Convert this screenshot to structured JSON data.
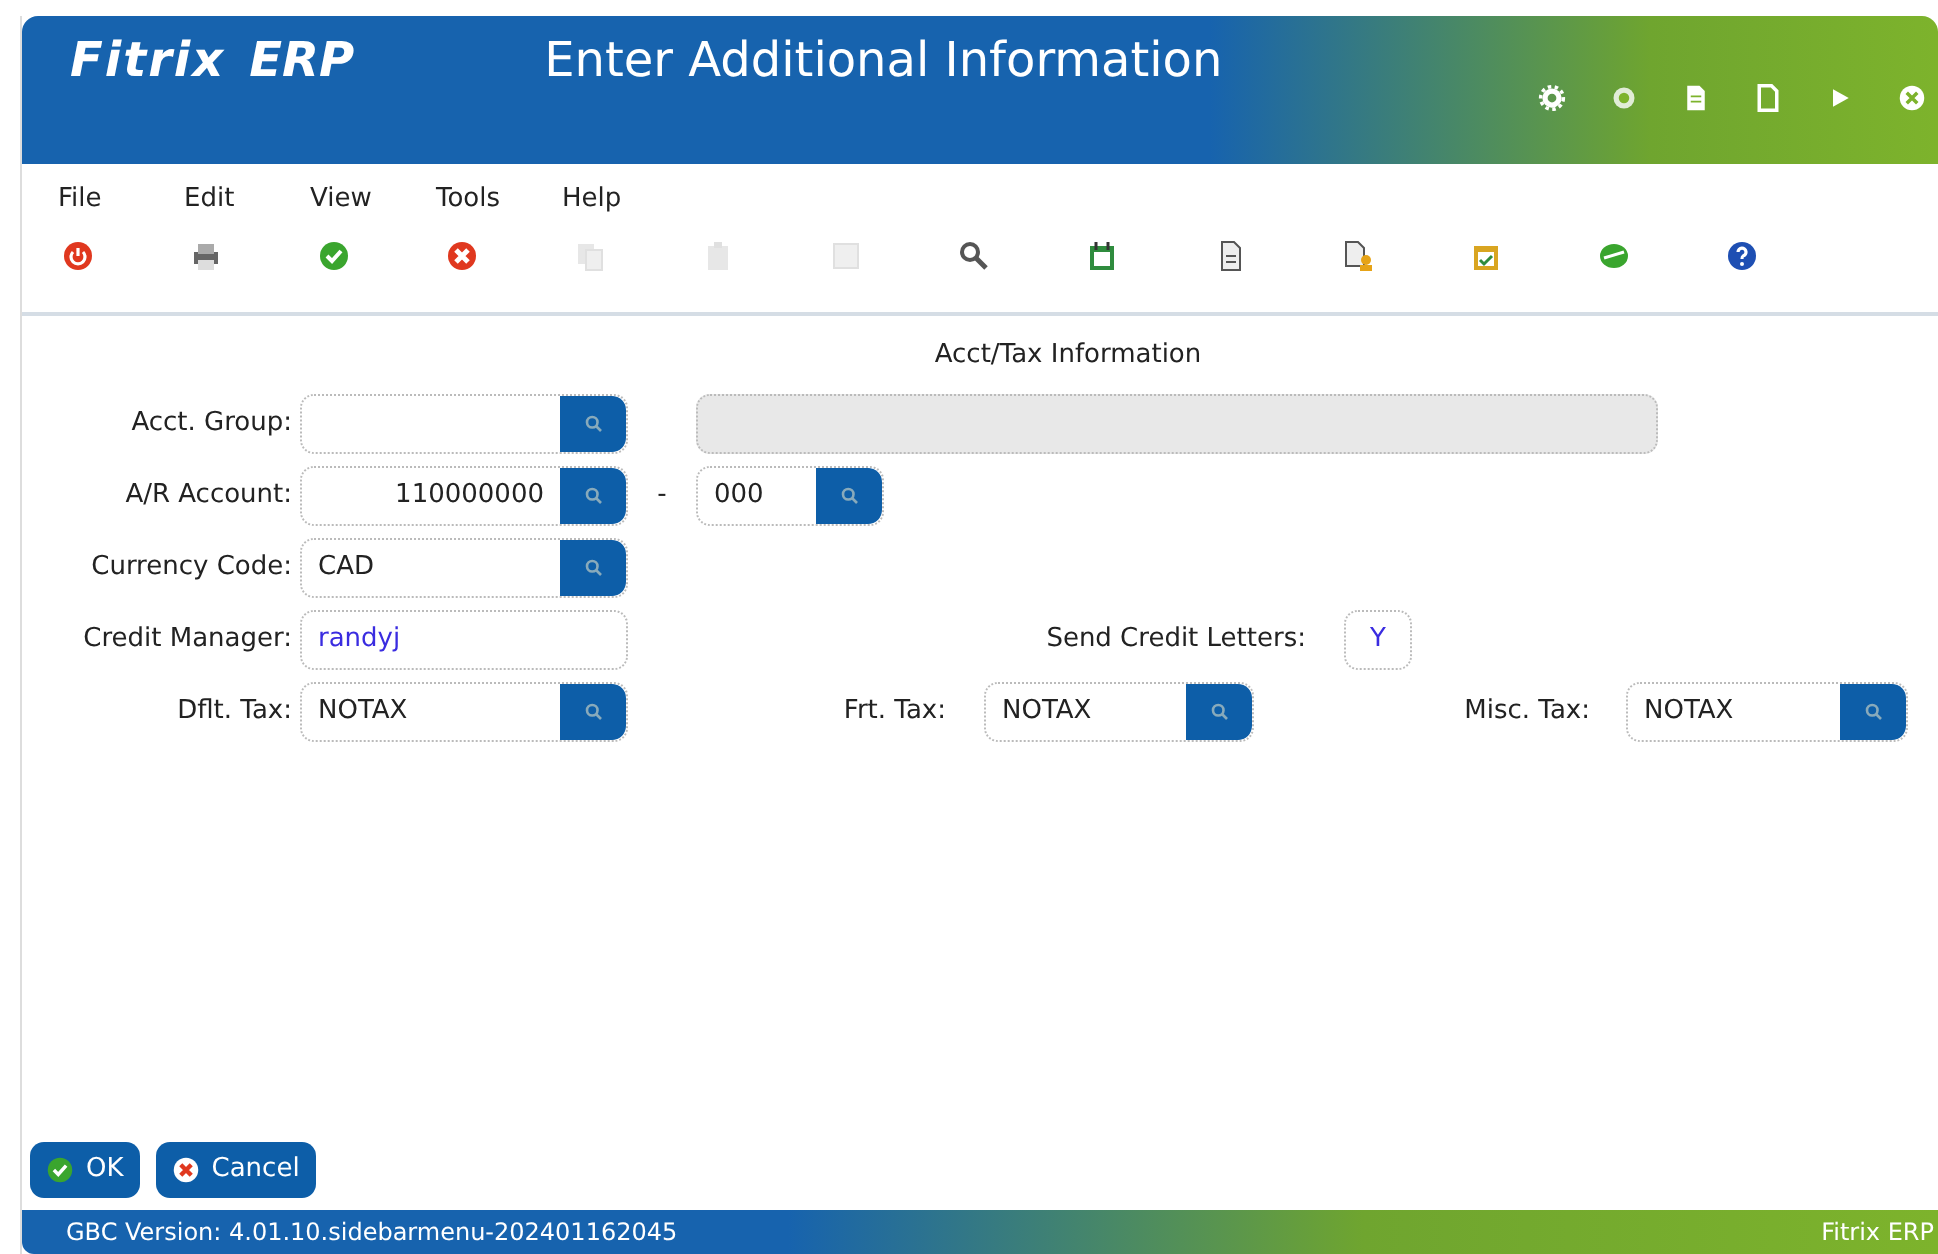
{
  "window": {
    "logo": "Fitrix",
    "logo_suffix": "ERP",
    "title": "Enter Additional Information"
  },
  "menu": [
    {
      "label": "File"
    },
    {
      "label": "Edit"
    },
    {
      "label": "View"
    },
    {
      "label": "Tools"
    },
    {
      "label": "Help"
    }
  ],
  "toolbar": [
    {
      "disabled": false
    },
    {
      "disabled": false
    },
    {
      "disabled": false
    },
    {
      "disabled": false
    },
    {
      "disabled": true
    },
    {
      "disabled": true
    },
    {
      "disabled": true
    },
    {
      "disabled": false
    },
    {
      "disabled": false
    },
    {
      "disabled": false
    },
    {
      "disabled": false
    },
    {
      "disabled": false
    },
    {
      "disabled": false
    },
    {
      "disabled": false
    }
  ],
  "section_title": "Acct/Tax Information",
  "rows": [
    [
      {
        "label": "Acct. Group:",
        "kind": "lookup",
        "disabled": false
      },
      {
        "kind": "display",
        "disabled": true
      }
    ],
    [
      {
        "label": "A/R Account:",
        "kind": "numeric-lookup",
        "value": "110000000",
        "disabled": false
      },
      {
        "separator": "-",
        "kind": "lookup",
        "value": "000",
        "disabled": false
      }
    ],
    [
      {
        "label": "Currency Code:",
        "kind": "lookup",
        "value": "CAD",
        "disabled": false
      }
    ],
    [
      {
        "label": "Credit Manager:",
        "kind": "text",
        "value": "randyj",
        "disabled": false
      },
      {
        "label": "Send Credit Letters:",
        "kind": "text",
        "value": "Y",
        "disabled": false
      }
    ],
    [
      {
        "label": "Dflt. Tax:",
        "kind": "lookup",
        "value": "NOTAX",
        "disabled": false
      },
      {
        "label": "Frt. Tax:",
        "kind": "lookup",
        "value": "NOTAX",
        "disabled": false
      },
      {
        "label": "Misc. Tax:",
        "kind": "lookup",
        "value": "NOTAX",
        "disabled": false
      }
    ]
  ],
  "buttons": [
    {
      "label": "OK",
      "kind": "ok"
    },
    {
      "label": "Cancel",
      "kind": "cancel"
    }
  ],
  "status_bar": {
    "version": "GBC Version: 4.01.10.sidebarmenu-202401162045",
    "product": "Fitrix ERP"
  }
}
